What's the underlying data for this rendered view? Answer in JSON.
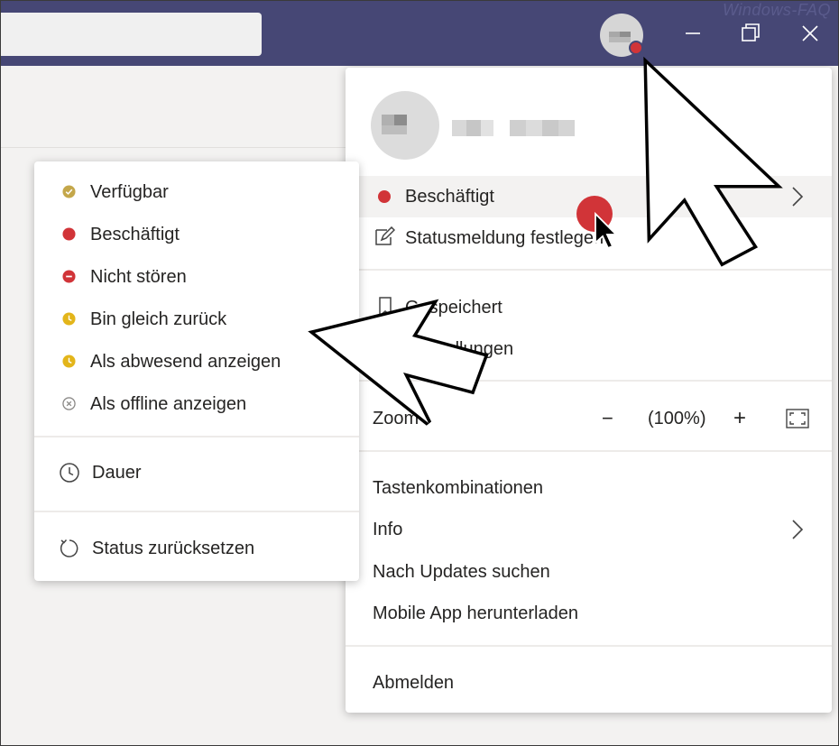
{
  "watermark": "Windows-FAQ",
  "status_menu": {
    "items": [
      {
        "label": "Verfügbar",
        "icon": "available-check-icon",
        "color": "#c4a74a"
      },
      {
        "label": "Beschäftigt",
        "icon": "busy-dot-icon",
        "color": "#d13438"
      },
      {
        "label": "Nicht stören",
        "icon": "do-not-disturb-icon",
        "color": "#d13438"
      },
      {
        "label": "Bin gleich zurück",
        "icon": "clock-away-icon",
        "color": "#e3b51a"
      },
      {
        "label": "Als abwesend anzeigen",
        "icon": "clock-away-icon",
        "color": "#e3b51a"
      },
      {
        "label": "Als offline anzeigen",
        "icon": "offline-x-icon",
        "color": "#8a8886"
      }
    ],
    "duration_label": "Dauer",
    "reset_label": "Status zurücksetzen"
  },
  "profile_menu": {
    "current_status": "Beschäftigt",
    "status_message": "Statusmeldung festlegen",
    "saved": "Gespeichert",
    "settings": "Einstellungen",
    "zoom_label": "Zoom",
    "zoom_value": "(100%)",
    "zoom_minus": "−",
    "zoom_plus": "+",
    "shortcuts": "Tastenkombinationen",
    "info": "Info",
    "updates": "Nach Updates suchen",
    "mobile_app": "Mobile App herunterladen",
    "logout": "Abmelden"
  },
  "colors": {
    "titlebar": "#464775",
    "busy": "#d13438",
    "away": "#e3b51a"
  }
}
